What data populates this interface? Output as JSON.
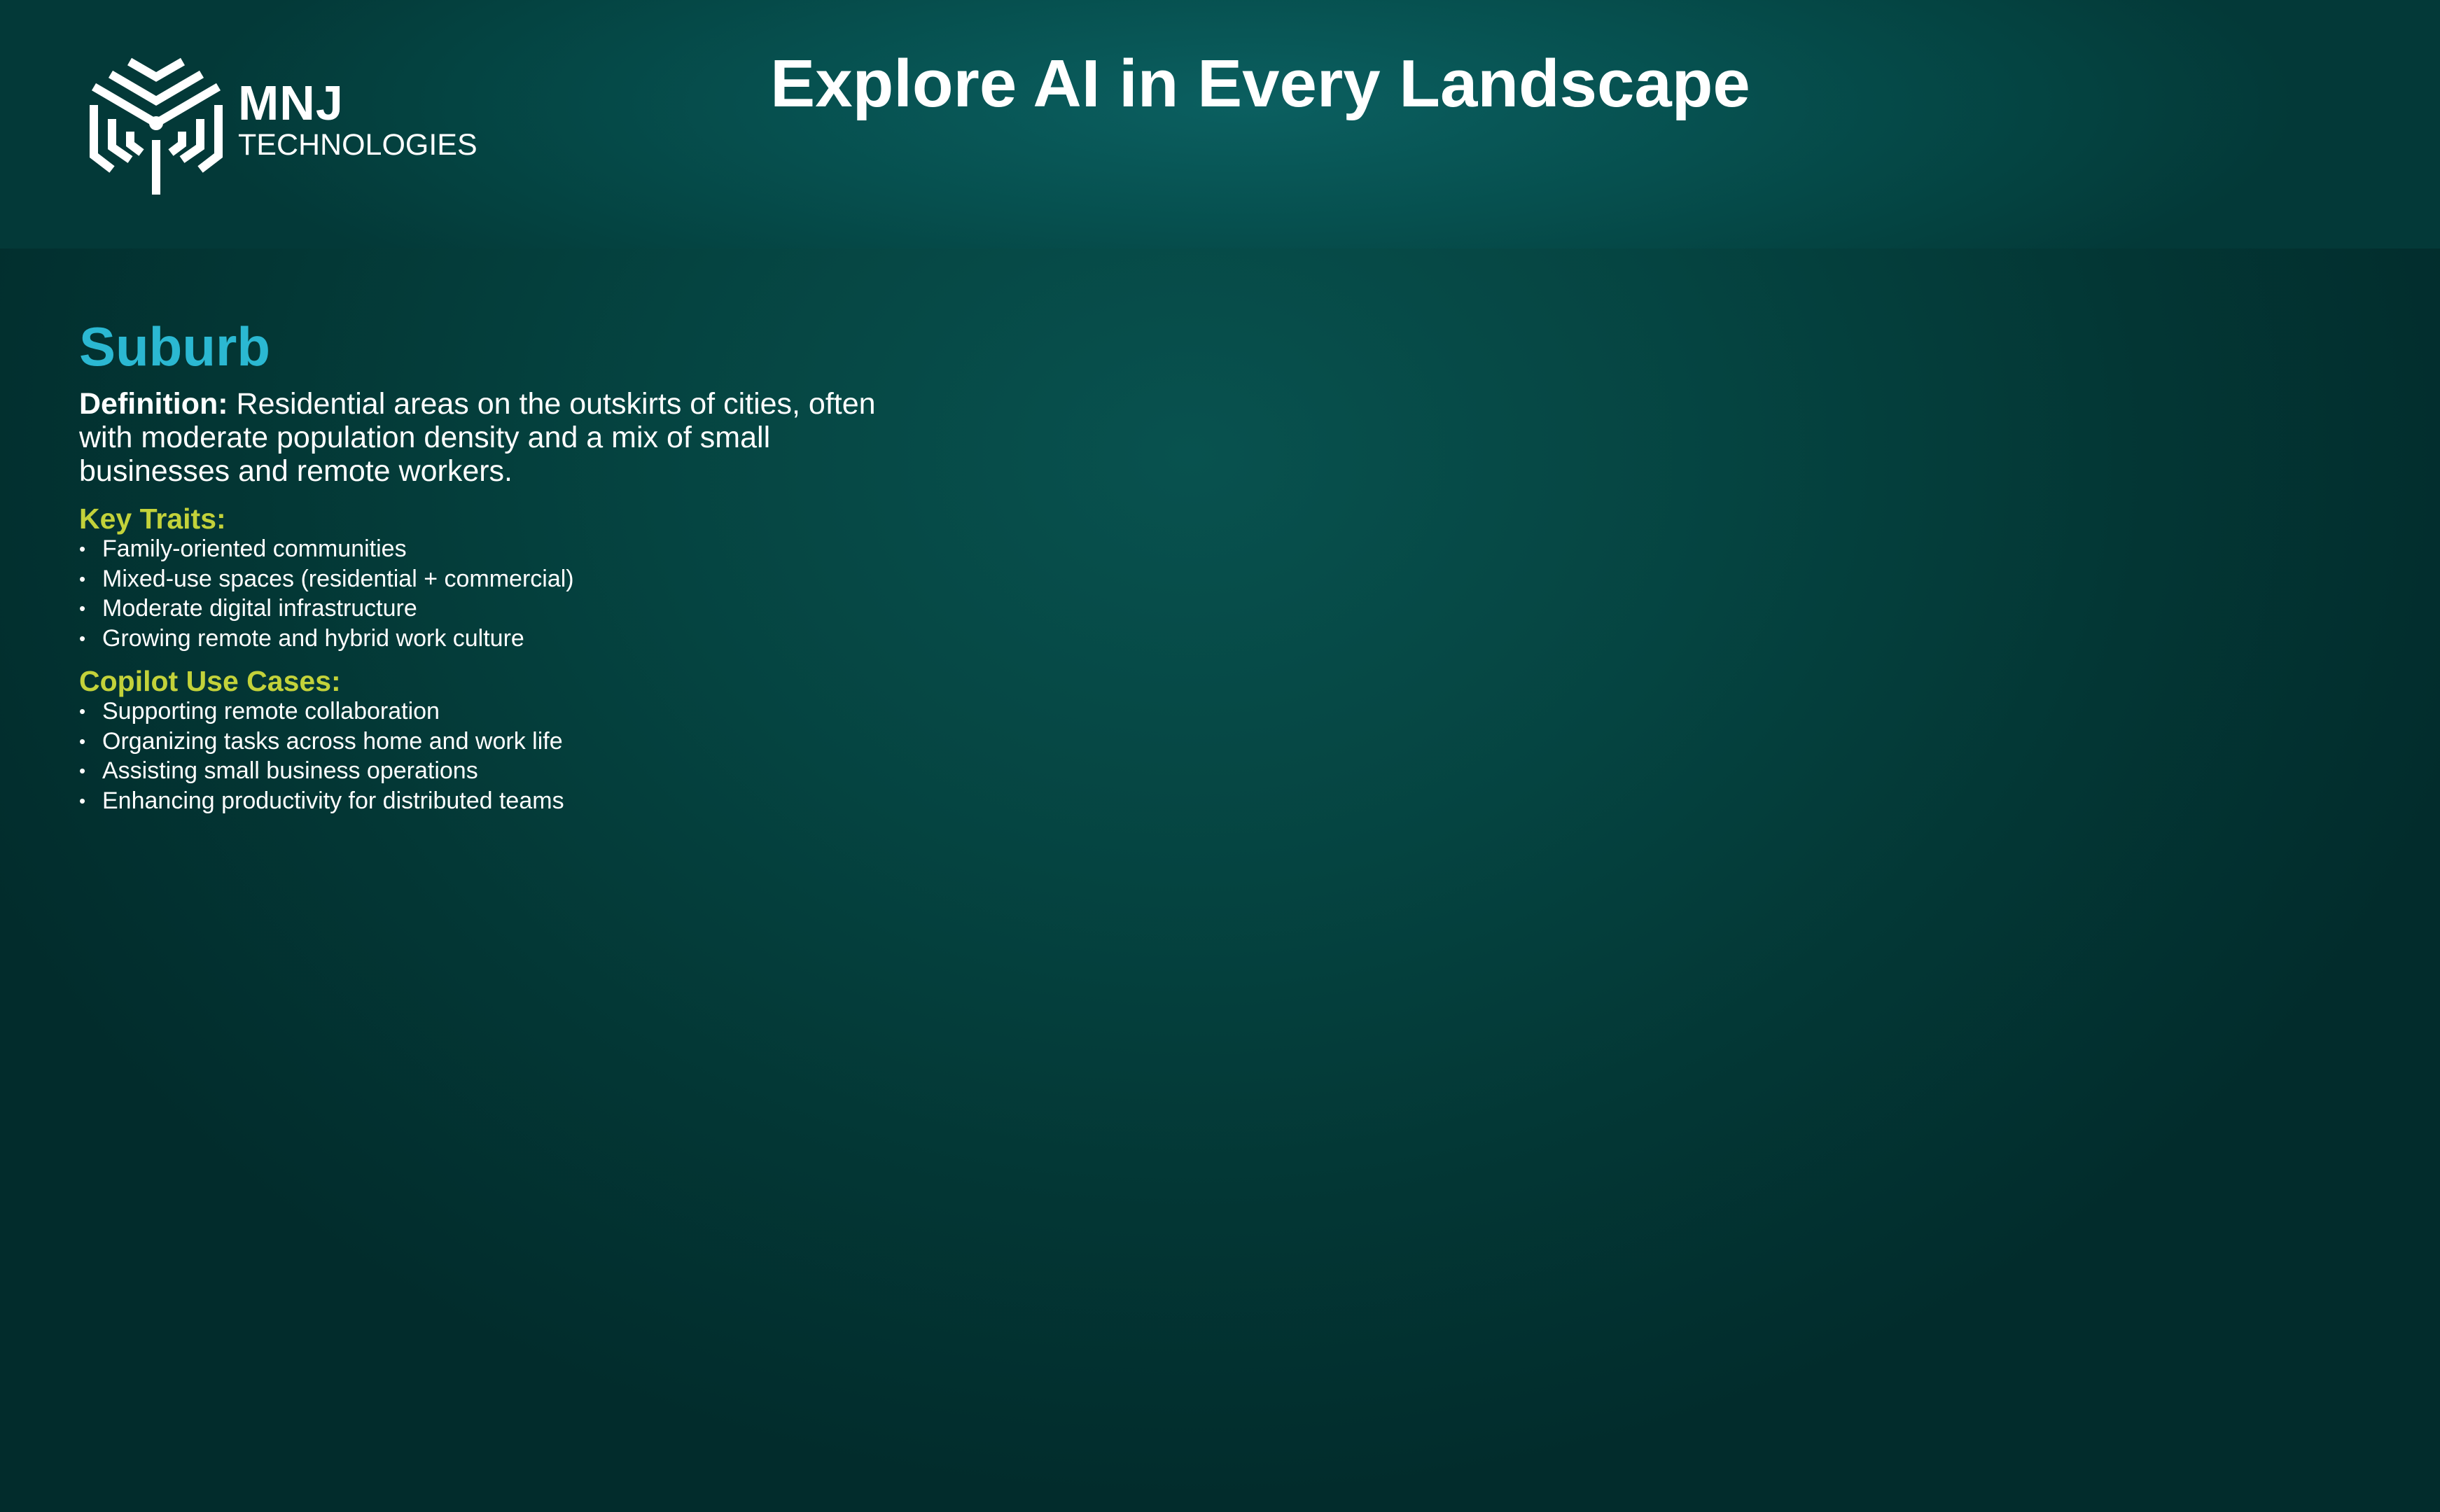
{
  "header": {
    "logo": {
      "name": "MNJ",
      "subtitle": "TECHNOLOGIES",
      "icon": "mnj-logo-icon"
    },
    "title": "Explore AI in Every Landscape"
  },
  "landscape": {
    "title": "Suburb",
    "definition_label": "Definition:",
    "definition_text": "Residential areas on the outskirts of cities, often with moderate population density and a mix of small businesses and remote workers.",
    "key_traits_heading": "Key Traits:",
    "key_traits": [
      "Family-oriented communities",
      "Mixed-use spaces (residential + commercial)",
      "Moderate digital infrastructure",
      "Growing remote and hybrid work culture"
    ],
    "use_cases_heading": "Copilot Use Cases:",
    "use_cases": [
      "Supporting remote collaboration",
      "Organizing tasks across home and work life",
      "Assisting small business operations",
      "Enhancing productivity for distributed teams"
    ]
  },
  "colors": {
    "accent_title": "#2bb8d2",
    "accent_heading": "#c3d23a",
    "background": "#033735"
  }
}
